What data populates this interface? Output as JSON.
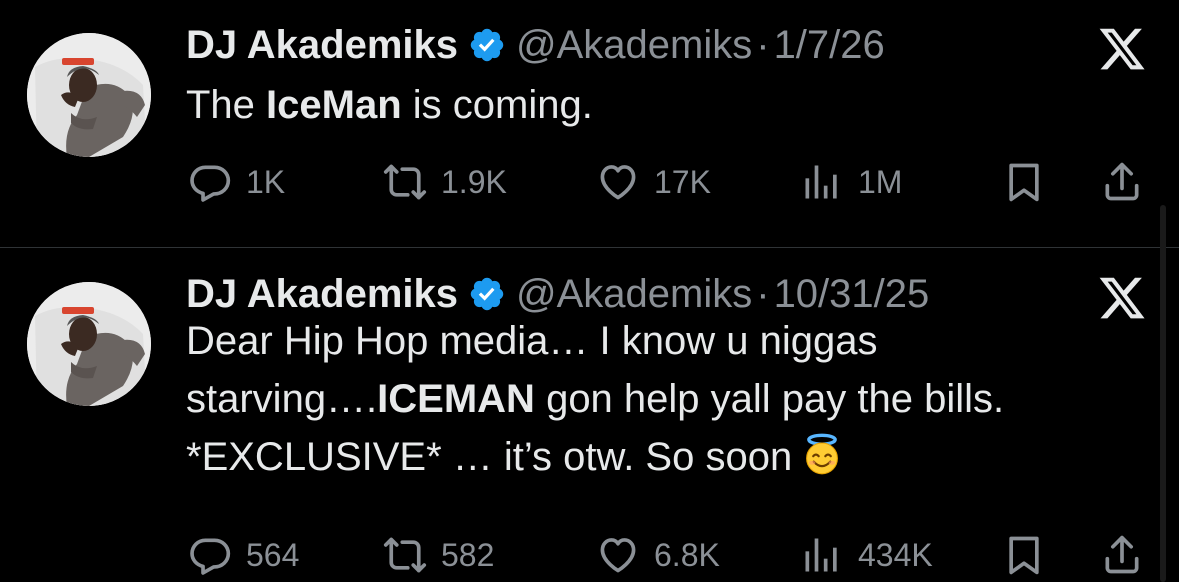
{
  "tweets": [
    {
      "author": {
        "name": "DJ Akademiks",
        "handle": "@Akademiks",
        "separator": "·",
        "date": "1/7/26"
      },
      "text": {
        "p1": "The ",
        "b1": "IceMan",
        "p2": " is coming."
      },
      "stats": {
        "replies": "1K",
        "reposts": "1.9K",
        "likes": "17K",
        "views": "1M"
      }
    },
    {
      "author": {
        "name": "DJ Akademiks",
        "handle": "@Akademiks",
        "separator": "·",
        "date": "10/31/25"
      },
      "text": {
        "line1": "Dear Hip Hop media… I know u niggas",
        "line2a": "starving….",
        "line2b": "ICEMAN",
        "line2c": " gon help yall pay the bills.",
        "line3": "*EXCLUSIVE* … it’s otw. So soon"
      },
      "stats": {
        "replies": "564",
        "reposts": "582",
        "likes": "6.8K",
        "views": "434K"
      }
    }
  ],
  "icons": [
    "verified-badge-icon",
    "x-logo-icon",
    "reply-icon",
    "repost-icon",
    "like-icon",
    "views-icon",
    "bookmark-icon",
    "share-icon",
    "smiling-face-with-halo-emoji"
  ],
  "colors": {
    "background": "#000000",
    "text": "#e7e9ea",
    "muted": "#8b9096",
    "verified": "#1d9bf0",
    "divider": "#2f3336"
  }
}
